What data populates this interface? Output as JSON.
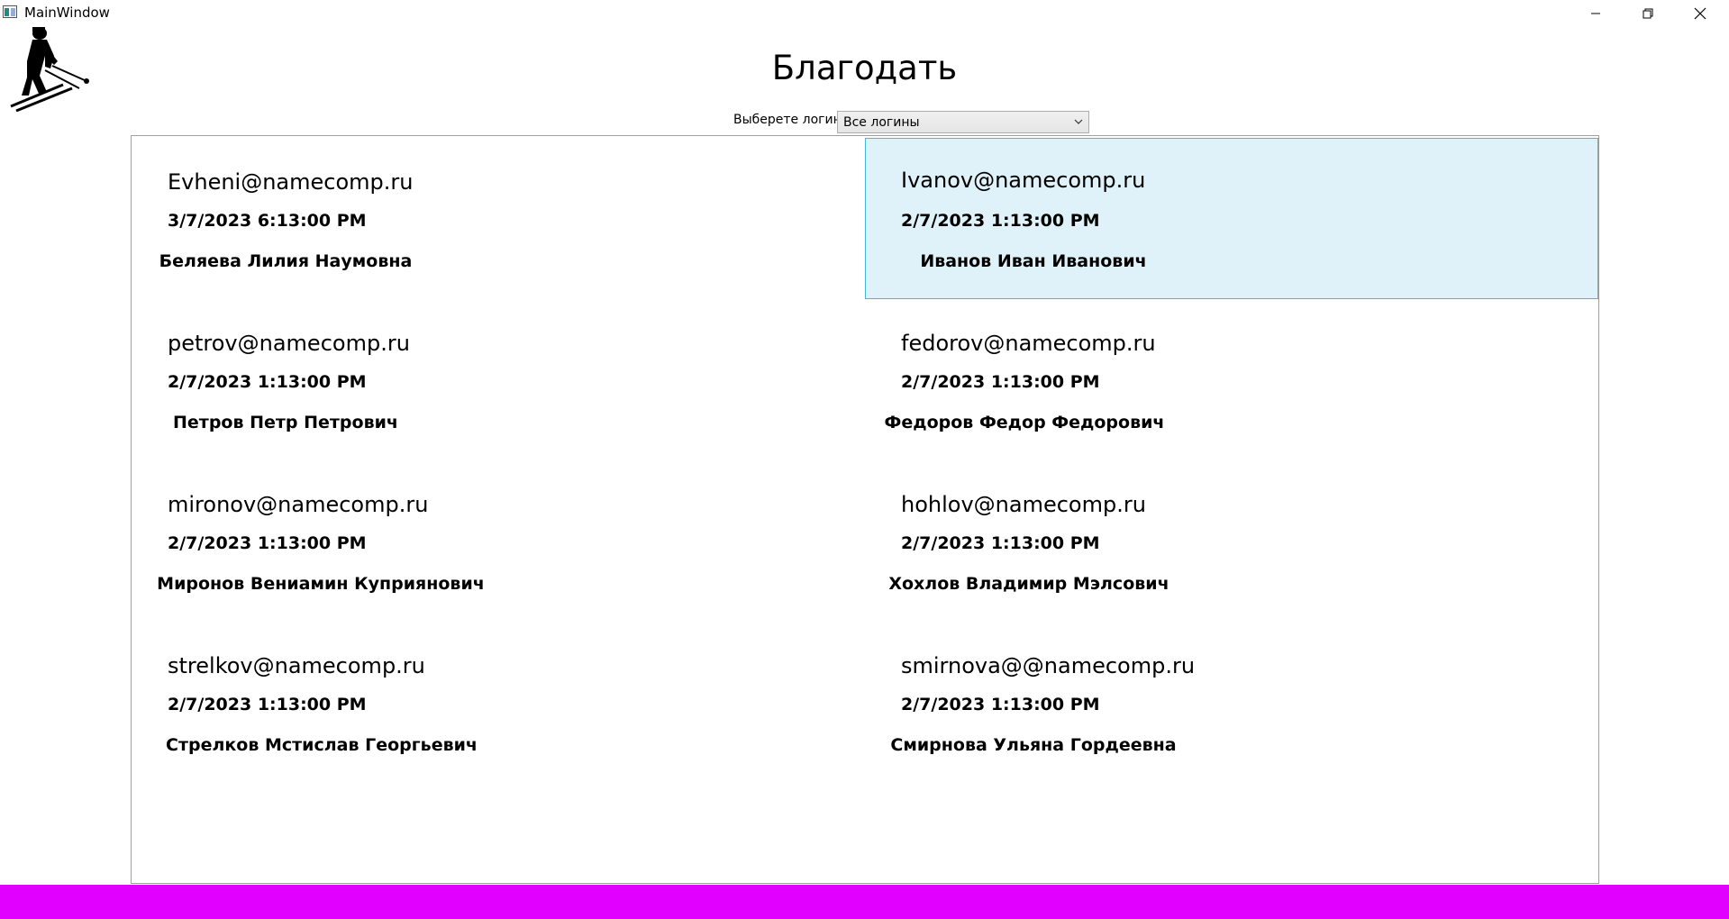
{
  "window": {
    "title": "MainWindow",
    "icon": "app-window-icon",
    "controls": [
      "minimize-icon",
      "restore-icon",
      "close-icon"
    ]
  },
  "logo": {
    "icon": "skier-icon"
  },
  "header": {
    "title": "Благодать"
  },
  "filter": {
    "label": "Выберете логин:",
    "selected": "Все логины"
  },
  "list": {
    "items": [
      {
        "login": "Evheni@namecomp.ru",
        "date": "3/7/2023 6:13:00 PM",
        "fio": "Беляева Лилия Наумовна",
        "selected": false
      },
      {
        "login": "Ivanov@namecomp.ru",
        "date": "2/7/2023 1:13:00 PM",
        "fio": "Иванов Иван Иванович",
        "selected": true
      },
      {
        "login": "petrov@namecomp.ru",
        "date": "2/7/2023 1:13:00 PM",
        "fio": "Петров Петр Петрович",
        "selected": false
      },
      {
        "login": "fedorov@namecomp.ru",
        "date": "2/7/2023 1:13:00 PM",
        "fio": "Федоров Федор Федорович",
        "selected": false
      },
      {
        "login": "mironov@namecomp.ru",
        "date": "2/7/2023 1:13:00 PM",
        "fio": "Миронов Вениамин Куприянович",
        "selected": false
      },
      {
        "login": "hohlov@namecomp.ru",
        "date": "2/7/2023 1:13:00 PM",
        "fio": "Хохлов Владимир Мэлсович",
        "selected": false
      },
      {
        "login": "strelkov@namecomp.ru",
        "date": "2/7/2023 1:13:00 PM",
        "fio": "Стрелков Мстислав Георгьевич",
        "selected": false
      },
      {
        "login": "smirnova@@namecomp.ru",
        "date": "2/7/2023 1:13:00 PM",
        "fio": "Смирнова Ульяна Гордеевна",
        "selected": false
      }
    ]
  },
  "colors": {
    "accent_bar": "#e100ff",
    "selected_bg": "#dff2f9",
    "selected_border": "#46b8df"
  }
}
